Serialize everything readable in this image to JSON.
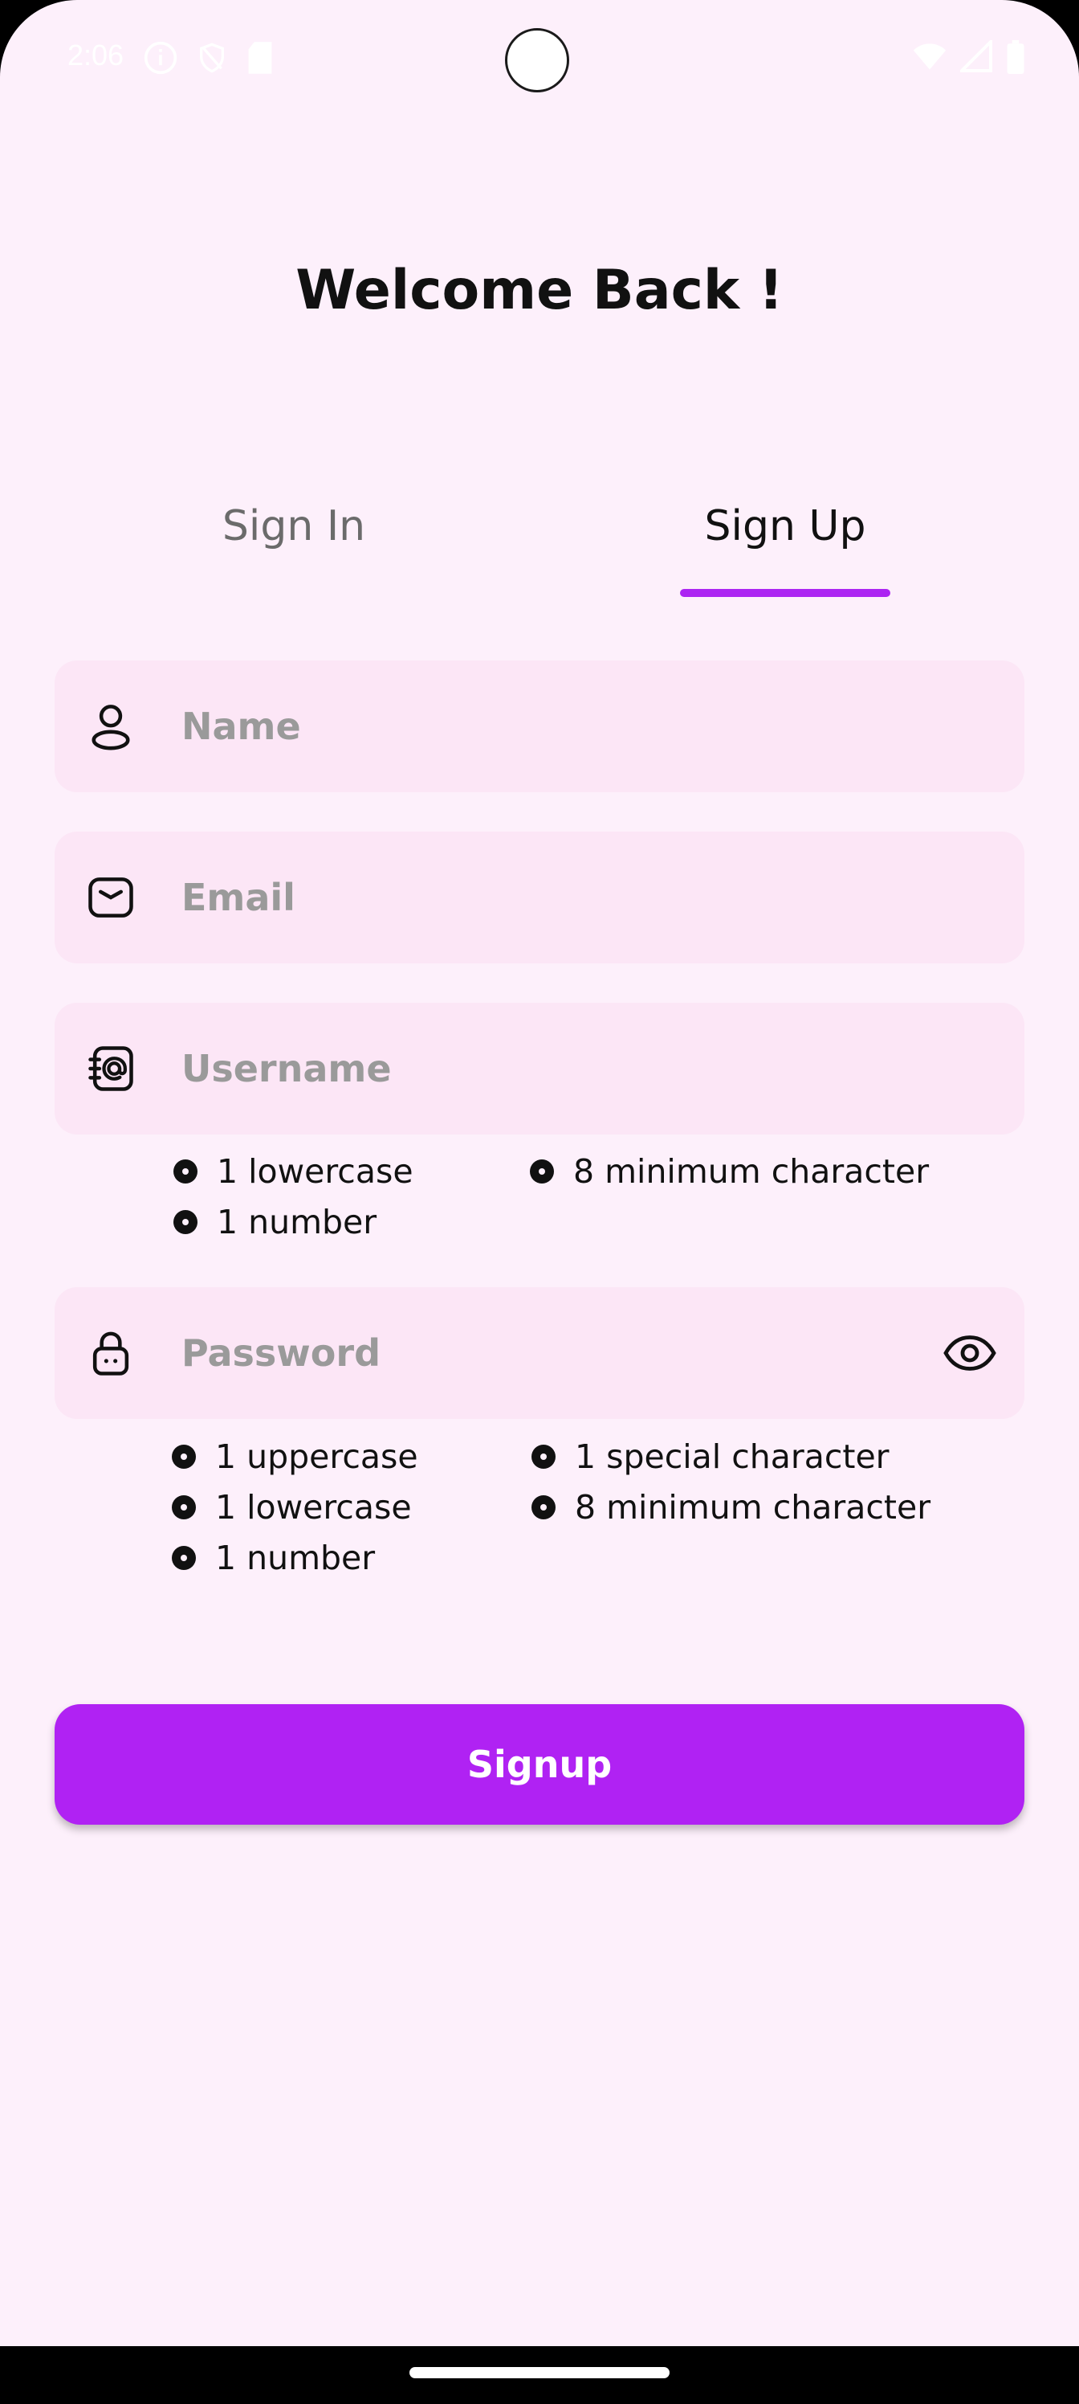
{
  "status_bar": {
    "time": "2:06",
    "left_icons": [
      "info-icon",
      "shield-icon",
      "sd-card-icon"
    ],
    "right_icons": [
      "wifi-icon",
      "signal-icon",
      "battery-icon"
    ]
  },
  "header": {
    "title": "Welcome Back !"
  },
  "tabs": [
    {
      "label": "Sign In",
      "active": false
    },
    {
      "label": "Sign Up",
      "active": true
    }
  ],
  "form": {
    "name": {
      "placeholder": "Name",
      "value": "",
      "icon": "person-icon"
    },
    "email": {
      "placeholder": "Email",
      "value": "",
      "icon": "mail-icon"
    },
    "username": {
      "placeholder": "Username",
      "value": "",
      "icon": "at-contact-icon",
      "requirements": [
        "1 lowercase",
        "8 minimum character",
        "1 number"
      ]
    },
    "password": {
      "placeholder": "Password",
      "value": "",
      "icon": "lock-icon",
      "toggle_icon": "eye-icon",
      "requirements": [
        "1 uppercase",
        "1 special character",
        "1 lowercase",
        "8 minimum character",
        "1 number"
      ]
    },
    "submit_label": "Signup"
  },
  "colors": {
    "background": "#fdf0fb",
    "field_background": "#fce6f6",
    "accent": "#b022f3",
    "tab_indicator": "#ac25f2"
  }
}
